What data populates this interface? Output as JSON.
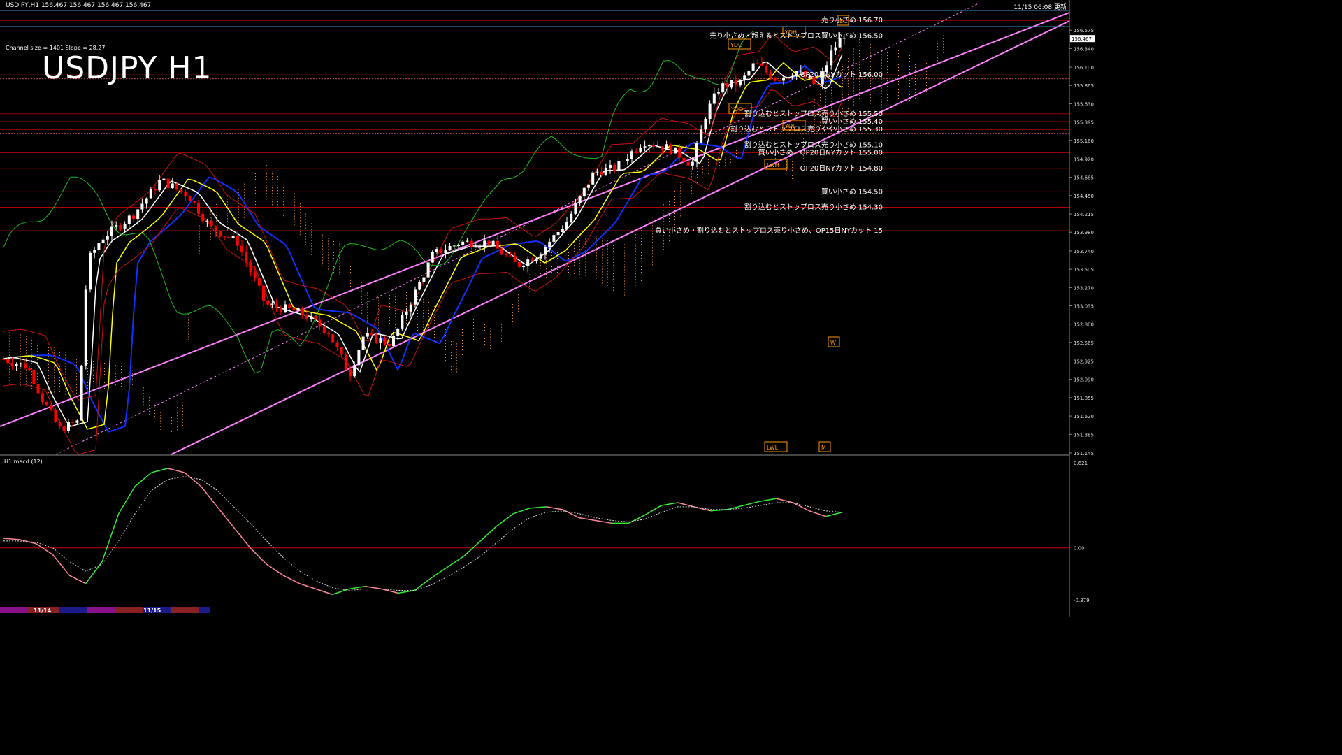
{
  "header": {
    "symbol_info": "USDJPY,H1  156.467 156.467 156.467 156.467",
    "updated": "11/15 06:08 更新",
    "title": "USDJPY H1",
    "channel_info": "Channel size = 1401 Slope = 28.27",
    "macd_label": "H1  macd (12)"
  },
  "colors": {
    "background": "#000000",
    "grid_red": "#cc0000",
    "channel": "#ff80ff",
    "ma_white": "#ffffff",
    "ma_yellow": "#ffff00",
    "ma_blue": "#1030ff",
    "chikou": "#22bb22",
    "bull": "#ffffff",
    "bear": "#ff0000",
    "macd_up": "#33ee33",
    "macd_down": "#ff8899"
  },
  "chart_data": {
    "type": "line",
    "price_axis": {
      "ylim": [
        151.145,
        156.72
      ],
      "ticks": [
        "156.575",
        "156.340",
        "156.100",
        "155.865",
        "155.630",
        "155.395",
        "155.160",
        "154.920",
        "154.685",
        "154.450",
        "154.215",
        "153.980",
        "153.740",
        "153.505",
        "153.270",
        "153.035",
        "152.800",
        "152.565",
        "152.325",
        "152.090",
        "151.855",
        "151.620",
        "151.385",
        "151.145"
      ],
      "current_price": "156.467"
    },
    "macd_axis": {
      "ylim": [
        -0.379,
        0.621
      ],
      "ticks": [
        "0.621",
        "0.00",
        "-0.379"
      ]
    },
    "time_labels": [
      "11/14",
      "11/15"
    ],
    "annotations": [
      {
        "price": 156.7,
        "text": "売り小さめ 156.70"
      },
      {
        "price": 156.5,
        "text": "売り小さめ・超えるとストップロス買い小さめ 156.50"
      },
      {
        "price": 156.0,
        "text": "OP20日NYカット 156.00"
      },
      {
        "price": 155.5,
        "text": "割り込むとストップロス売り小さめ 155.50"
      },
      {
        "price": 155.4,
        "text": "買い小さめ 155.40"
      },
      {
        "price": 155.3,
        "text": "割り込むとストップロス売りやや小さめ 155.30"
      },
      {
        "price": 155.1,
        "text": "割り込むとストップロス売り小さめ 155.10"
      },
      {
        "price": 155.0,
        "text": "買い小さめ、OP20日NYカット 155.00"
      },
      {
        "price": 154.8,
        "text": "OP20日NYカット 154.80"
      },
      {
        "price": 154.5,
        "text": "買い小さめ 154.50"
      },
      {
        "price": 154.3,
        "text": "割り込むとストップロス売り小さめ 154.30"
      },
      {
        "price": 154.0,
        "text": "買い小さめ・割り込むとストップロス売り小さめ、OP15日NYカット 15"
      }
    ],
    "markers": [
      "YDH",
      "YDC",
      "YDO",
      "YDL",
      "LWH",
      "LWL",
      "D",
      "W",
      "M"
    ],
    "macd_series": [
      {
        "values": [
          0.07,
          0.06,
          0.03,
          -0.05,
          -0.2,
          -0.26,
          -0.1,
          0.25,
          0.45,
          0.55,
          0.58,
          0.55,
          0.45,
          0.3,
          0.15,
          0.0,
          -0.12,
          -0.2,
          -0.26,
          -0.3,
          -0.34,
          -0.3,
          -0.28,
          -0.3,
          -0.33,
          -0.31,
          -0.22,
          -0.14,
          -0.06,
          0.05,
          0.16,
          0.25,
          0.29,
          0.3,
          0.28,
          0.22,
          0.2,
          0.18,
          0.18,
          0.24,
          0.31,
          0.33,
          0.3,
          0.27,
          0.28,
          0.31,
          0.34,
          0.36,
          0.33,
          0.27,
          0.23,
          0.26
        ]
      },
      {
        "values": [
          0.05,
          0.05,
          0.04,
          0.0,
          -0.1,
          -0.17,
          -0.12,
          0.05,
          0.25,
          0.42,
          0.5,
          0.52,
          0.5,
          0.42,
          0.3,
          0.18,
          0.05,
          -0.07,
          -0.17,
          -0.24,
          -0.29,
          -0.31,
          -0.3,
          -0.3,
          -0.31,
          -0.31,
          -0.27,
          -0.21,
          -0.14,
          -0.06,
          0.04,
          0.14,
          0.22,
          0.26,
          0.27,
          0.25,
          0.22,
          0.2,
          0.19,
          0.21,
          0.26,
          0.3,
          0.3,
          0.28,
          0.28,
          0.29,
          0.31,
          0.33,
          0.33,
          0.3,
          0.27,
          0.26
        ]
      }
    ]
  }
}
